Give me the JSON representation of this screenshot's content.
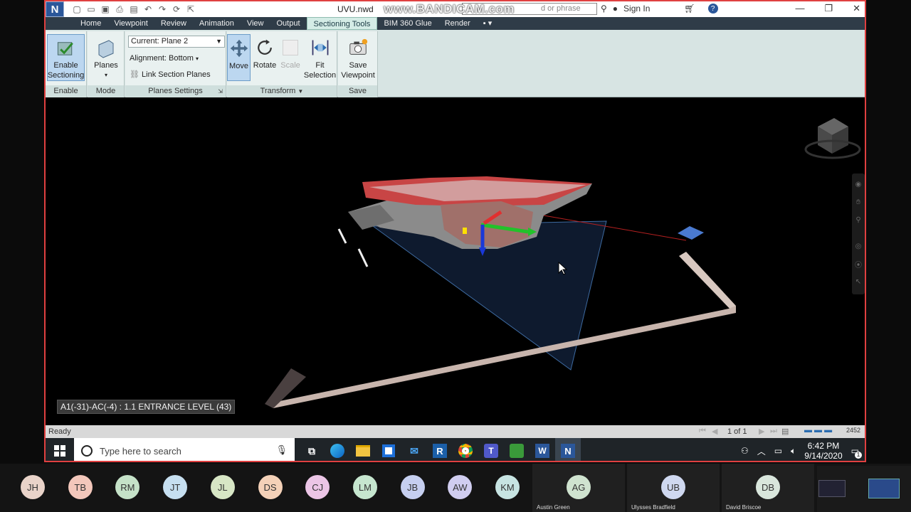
{
  "window": {
    "doc_title": "UVU.nwd",
    "search_placeholder": "d or phrase",
    "watermark": "www.BANDICAM.com",
    "sign_in": "Sign In",
    "help": "?",
    "app_letter": "N"
  },
  "menu": {
    "tabs": [
      {
        "label": "Home"
      },
      {
        "label": "Viewpoint"
      },
      {
        "label": "Review"
      },
      {
        "label": "Animation"
      },
      {
        "label": "View"
      },
      {
        "label": "Output"
      },
      {
        "label": "Sectioning Tools"
      },
      {
        "label": "BIM 360 Glue"
      },
      {
        "label": "Render"
      }
    ]
  },
  "ribbon": {
    "enable": {
      "btn": "Enable Sectioning",
      "panel": "Enable"
    },
    "mode": {
      "btn": "Planes",
      "panel": "Mode"
    },
    "planes_settings": {
      "current": "Current: Plane 2",
      "alignment": "Alignment: Bottom",
      "link": "Link Section Planes",
      "panel": "Planes Settings"
    },
    "transform": {
      "move": "Move",
      "rotate": "Rotate",
      "scale": "Scale",
      "fit": "Fit Selection",
      "panel": "Transform"
    },
    "save": {
      "btn": "Save Viewpoint",
      "panel": "Save"
    }
  },
  "viewport": {
    "status_text": "A1(-31)-AC(-4) : 1.1 ENTRANCE LEVEL (43)"
  },
  "statusbar": {
    "ready": "Ready",
    "pager": "1 of 1",
    "mem": "2452"
  },
  "taskbar": {
    "search_placeholder": "Type here to search",
    "time": "6:42 PM",
    "date": "9/14/2020",
    "notif_count": "1"
  },
  "participants": [
    {
      "initials": "JH",
      "color": "#e9d3c9"
    },
    {
      "initials": "TB",
      "color": "#f3c7bb"
    },
    {
      "initials": "RM",
      "color": "#c5e2c8"
    },
    {
      "initials": "JT",
      "color": "#c6dff0"
    },
    {
      "initials": "JL",
      "color": "#d7e6c5"
    },
    {
      "initials": "DS",
      "color": "#f4d1b8"
    },
    {
      "initials": "CJ",
      "color": "#ecc5e6"
    },
    {
      "initials": "LM",
      "color": "#c6e6cf"
    },
    {
      "initials": "JB",
      "color": "#c6cff0"
    },
    {
      "initials": "AW",
      "color": "#d0cdf0"
    },
    {
      "initials": "KM",
      "color": "#c7e4e2"
    }
  ],
  "video_participants": [
    {
      "initials": "AG",
      "name": "Austin Green",
      "color": "#cfe3cf"
    },
    {
      "initials": "UB",
      "name": "Ulysses Bradfield",
      "color": "#cfd8f0"
    },
    {
      "initials": "DB",
      "name": "David Briscoe",
      "color": "#d9e6dc"
    }
  ]
}
